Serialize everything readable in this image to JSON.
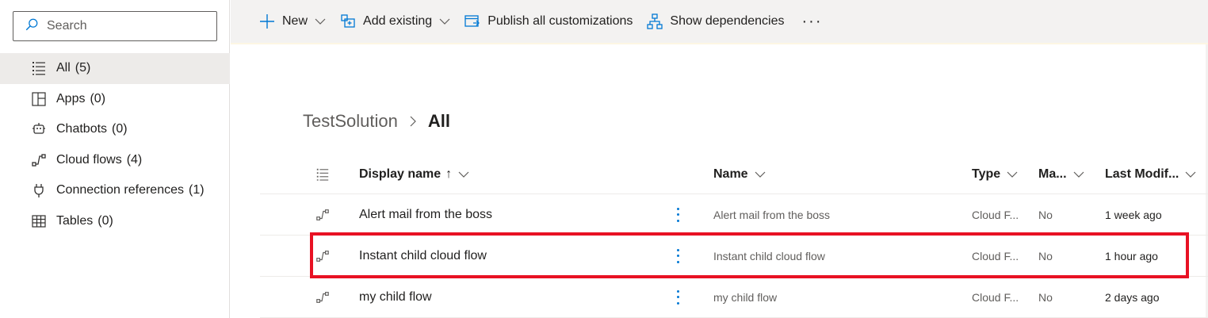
{
  "search": {
    "placeholder": "Search"
  },
  "sidebar": {
    "items": [
      {
        "label": "All",
        "count": "(5)",
        "icon": "list-icon",
        "active": true
      },
      {
        "label": "Apps",
        "count": "(0)",
        "icon": "apps-icon"
      },
      {
        "label": "Chatbots",
        "count": "(0)",
        "icon": "chatbot-icon"
      },
      {
        "label": "Cloud flows",
        "count": "(4)",
        "icon": "flow-icon"
      },
      {
        "label": "Connection references",
        "count": "(1)",
        "icon": "plug-icon"
      },
      {
        "label": "Tables",
        "count": "(0)",
        "icon": "table-icon"
      }
    ]
  },
  "toolbar": {
    "new_label": "New",
    "add_existing_label": "Add existing",
    "publish_label": "Publish all customizations",
    "dependencies_label": "Show dependencies",
    "more_label": "···"
  },
  "breadcrumb": {
    "root": "TestSolution",
    "current": "All"
  },
  "grid": {
    "columns": {
      "display_name": "Display name",
      "sort_indicator": "↑",
      "name": "Name",
      "type": "Type",
      "managed": "Ma...",
      "last_modified": "Last Modif..."
    },
    "rows": [
      {
        "display_name": "Alert mail from the boss",
        "name": "Alert mail from the boss",
        "type": "Cloud F...",
        "managed": "No",
        "modified": "1 week ago"
      },
      {
        "display_name": "Instant child cloud flow",
        "name": "Instant child cloud flow",
        "type": "Cloud F...",
        "managed": "No",
        "modified": "1 hour ago"
      },
      {
        "display_name": "my child flow",
        "name": "my child flow",
        "type": "Cloud F...",
        "managed": "No",
        "modified": "2 days ago"
      }
    ]
  },
  "colors": {
    "accent": "#0078d4",
    "highlight": "#e81123",
    "selected_bg": "#edebe9"
  }
}
